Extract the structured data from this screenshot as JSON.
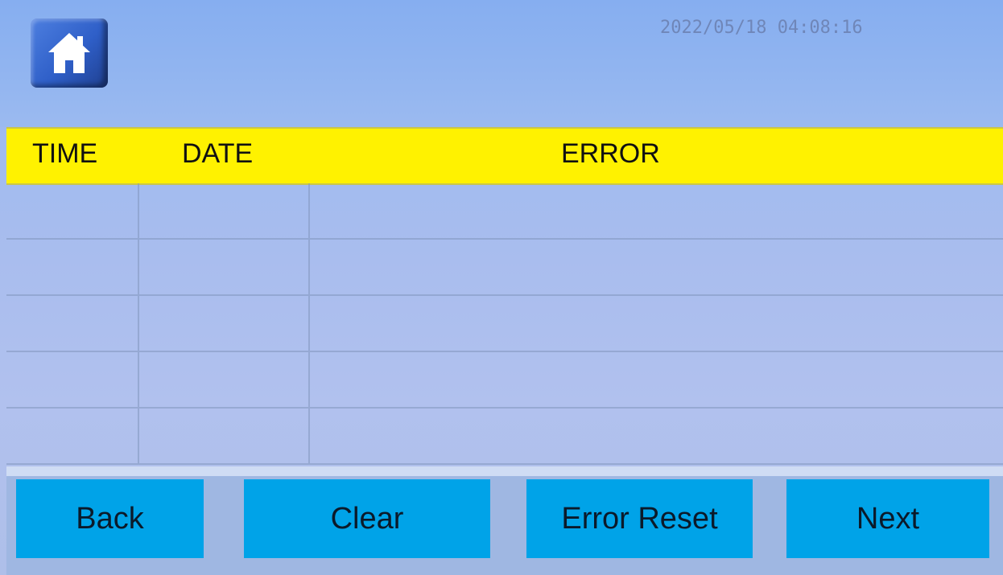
{
  "header": {
    "datetime": "2022/05/18 04:08:16",
    "home_icon": "home-icon"
  },
  "table": {
    "columns": [
      "TIME",
      "DATE",
      "ERROR"
    ],
    "rows": [
      {
        "time": "",
        "date": "",
        "error": ""
      },
      {
        "time": "",
        "date": "",
        "error": ""
      },
      {
        "time": "",
        "date": "",
        "error": ""
      },
      {
        "time": "",
        "date": "",
        "error": ""
      },
      {
        "time": "",
        "date": "",
        "error": ""
      }
    ]
  },
  "buttons": {
    "back": "Back",
    "clear": "Clear",
    "error_reset": "Error Reset",
    "next": "Next"
  },
  "colors": {
    "header_row_bg": "#fff200",
    "button_bg": "#00a3e8",
    "screen_bg": "#9dbaf0"
  }
}
